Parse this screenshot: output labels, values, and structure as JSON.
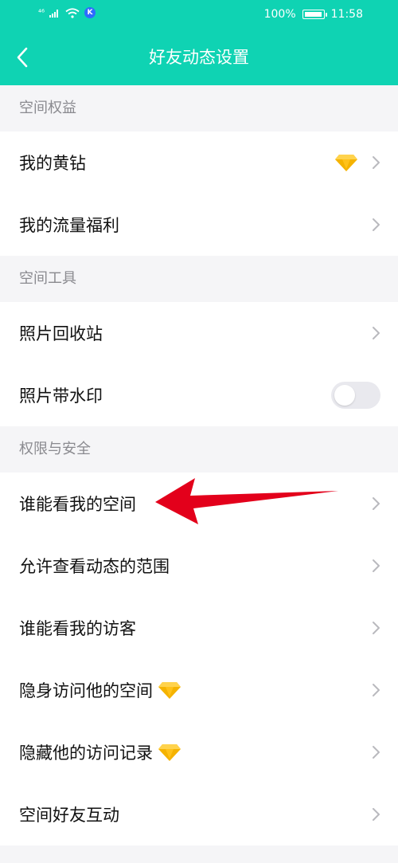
{
  "status_bar": {
    "signal_text": "⁴⁶",
    "battery_percent": "100%",
    "time": "11:58",
    "app_badge": "K",
    "battery_level": 1.0
  },
  "header": {
    "title": "好友动态设置",
    "back_icon": "chevron-left-icon"
  },
  "sections": [
    {
      "label": "空间权益",
      "items": [
        {
          "label": "我的黄钻",
          "right_icon": "diamond-icon"
        },
        {
          "label": "我的流量福利"
        }
      ]
    },
    {
      "label": "空间工具",
      "items": [
        {
          "label": "照片回收站"
        },
        {
          "label": "照片带水印",
          "toggle": false
        }
      ]
    },
    {
      "label": "权限与安全",
      "items": [
        {
          "label": "谁能看我的空间"
        },
        {
          "label": "允许查看动态的范围"
        },
        {
          "label": "谁能看我的访客"
        },
        {
          "label": "隐身访问他的空间",
          "inline_icon": "diamond-icon"
        },
        {
          "label": "隐藏他的访问记录",
          "inline_icon": "diamond-icon"
        },
        {
          "label": "空间好友互动"
        }
      ]
    }
  ],
  "colors": {
    "accent": "#0fd3b3",
    "diamond": "#f5b301",
    "annotation_arrow": "#e3001b"
  }
}
